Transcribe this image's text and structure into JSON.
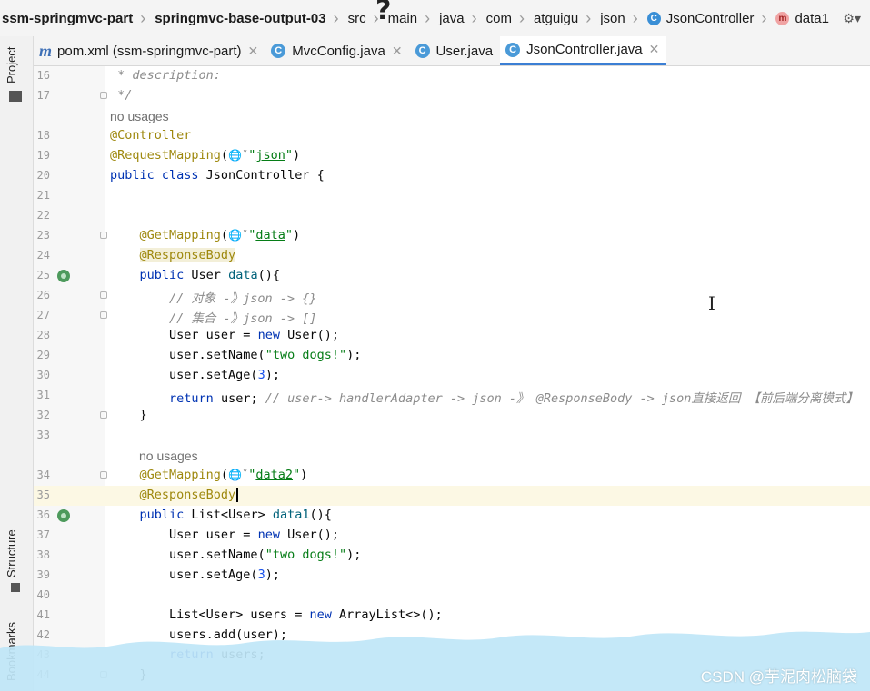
{
  "breadcrumb": {
    "items": [
      "ssm-springmvc-part",
      "springmvc-base-output-03",
      "src",
      "main",
      "java",
      "com",
      "atguigu",
      "json",
      "JsonController",
      "data1"
    ]
  },
  "tabs": [
    {
      "label": "pom.xml (ssm-springmvc-part)"
    },
    {
      "label": "MvcConfig.java"
    },
    {
      "label": "User.java"
    },
    {
      "label": "JsonController.java"
    }
  ],
  "side_panels": {
    "project": "Project",
    "structure": "Structure",
    "bookmarks": "Bookmarks"
  },
  "editor": {
    "usage_hint_1": "no usages",
    "usage_hint_2": "no usages",
    "line_numbers": [
      "16",
      "17",
      "18",
      "19",
      "20",
      "21",
      "22",
      "23",
      "24",
      "25",
      "26",
      "27",
      "28",
      "29",
      "30",
      "31",
      "32",
      "33",
      "34",
      "35",
      "36",
      "37",
      "38",
      "39",
      "40",
      "41",
      "42",
      "43",
      "44"
    ]
  },
  "watermark": "CSDN @芋泥肉松脑袋",
  "colors": {
    "keyword": "#0033b3",
    "annotation": "#9e880d",
    "string": "#067d17",
    "comment": "#8c8c8c",
    "number": "#1750eb",
    "accent": "#3c7fd4"
  }
}
